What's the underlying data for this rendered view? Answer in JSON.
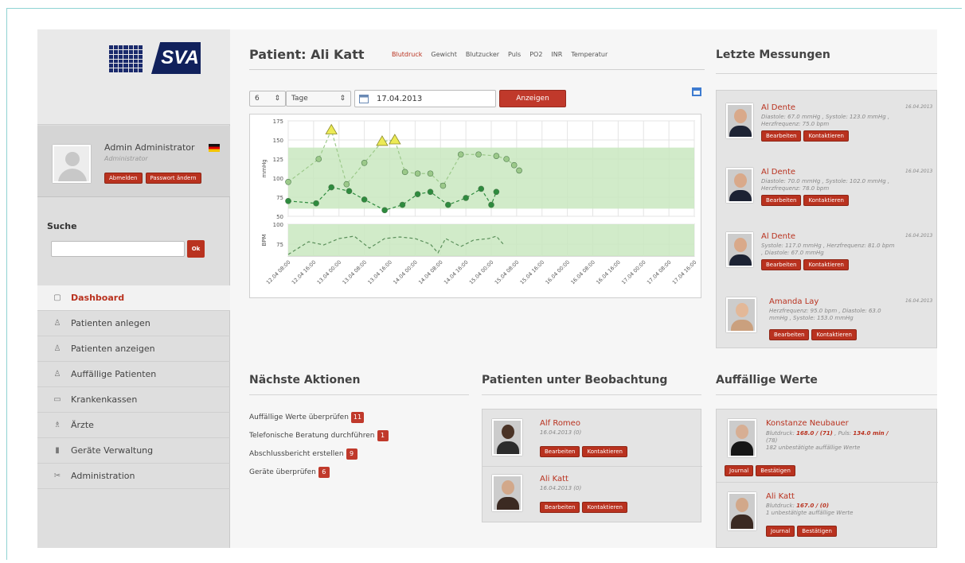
{
  "sidebar": {
    "user": {
      "name": "Admin Administrator",
      "role": "Administrator",
      "btn_logout": "Abmelden",
      "btn_password": "Passwort ändern"
    },
    "search": {
      "label": "Suche",
      "button": "Ok",
      "placeholder": ""
    },
    "nav": [
      {
        "label": "Dashboard",
        "icon": "dashboard-icon",
        "active": true
      },
      {
        "label": "Patienten anlegen",
        "icon": "user-add-icon"
      },
      {
        "label": "Patienten anzeigen",
        "icon": "user-icon"
      },
      {
        "label": "Auffällige Patienten",
        "icon": "user-alert-icon"
      },
      {
        "label": "Krankenkassen",
        "icon": "card-icon"
      },
      {
        "label": "Ärzte",
        "icon": "doctor-icon"
      },
      {
        "label": "Geräte Verwaltung",
        "icon": "device-icon"
      },
      {
        "label": "Administration",
        "icon": "wrench-icon"
      }
    ]
  },
  "patient": {
    "title": "Patient: Ali Katt",
    "tabs": [
      "Blutdruck",
      "Gewicht",
      "Blutzucker",
      "Puls",
      "PO2",
      "INR",
      "Temperatur"
    ],
    "controls": {
      "count": "6",
      "unit": "Tage",
      "date": "17.04.2013",
      "show_button": "Anzeigen"
    }
  },
  "chart_data": {
    "type": "line",
    "x": [
      "12.04 08:00",
      "12.04 16:00",
      "13.04 00:00",
      "13.04 08:00",
      "13.04 16:00",
      "14.04 00:00",
      "14.04 08:00",
      "14.04 16:00",
      "15.04 00:00",
      "15.04 08:00",
      "15.04 16:00",
      "16.04 00:00",
      "16.04 08:00",
      "16.04 16:00",
      "17.04 00:00",
      "17.04 08:00",
      "17.04 16:00"
    ],
    "panels": [
      {
        "ylabel": "mmHg",
        "ylim": [
          50,
          175
        ],
        "yticks": [
          50,
          75,
          100,
          125,
          150,
          175
        ],
        "normal_range": [
          60,
          140
        ],
        "series": [
          {
            "points": [
              [
                0,
                95
              ],
              [
                1.2,
                125
              ],
              [
                1.7,
                163
              ],
              [
                2.3,
                92
              ],
              [
                3.0,
                120
              ],
              [
                3.7,
                148
              ],
              [
                4.2,
                150
              ],
              [
                4.6,
                108
              ],
              [
                5.1,
                106
              ],
              [
                5.6,
                106
              ],
              [
                6.1,
                90
              ],
              [
                6.8,
                131
              ],
              [
                7.5,
                131
              ],
              [
                8.2,
                129
              ],
              [
                8.6,
                125
              ],
              [
                8.9,
                117
              ],
              [
                9.1,
                110
              ]
            ],
            "triangle_indices": [
              2,
              5,
              6
            ]
          },
          {
            "points": [
              [
                0,
                70
              ],
              [
                1.1,
                67
              ],
              [
                1.7,
                88
              ],
              [
                2.4,
                83
              ],
              [
                3.0,
                72
              ],
              [
                3.8,
                58
              ],
              [
                4.5,
                65
              ],
              [
                5.1,
                79
              ],
              [
                5.6,
                82
              ],
              [
                6.3,
                65
              ],
              [
                7.0,
                74
              ],
              [
                7.6,
                86
              ],
              [
                8.0,
                65
              ],
              [
                8.2,
                82
              ]
            ]
          }
        ]
      },
      {
        "ylabel": "BPM",
        "ylim": [
          60,
          100
        ],
        "yticks": [
          75,
          100
        ],
        "normal_range": [
          60,
          100
        ],
        "series": [
          {
            "points": [
              [
                0,
                62
              ],
              [
                0.8,
                78
              ],
              [
                1.4,
                74
              ],
              [
                2.0,
                82
              ],
              [
                2.6,
                85
              ],
              [
                3.2,
                70
              ],
              [
                3.8,
                82
              ],
              [
                4.4,
                84
              ],
              [
                5.0,
                82
              ],
              [
                5.6,
                75
              ],
              [
                5.9,
                64
              ],
              [
                6.2,
                82
              ],
              [
                6.8,
                72
              ],
              [
                7.3,
                80
              ],
              [
                7.9,
                82
              ],
              [
                8.2,
                85
              ],
              [
                8.5,
                74
              ]
            ]
          }
        ]
      }
    ]
  },
  "last_measurements": {
    "title": "Letzte Messungen",
    "items": [
      {
        "name": "Al Dente",
        "date": "16.04.2013",
        "text1": "Diastole: 67.0 mmHg , Systole: 123.0 mmHg ,",
        "text2": "Herzfrequenz: 75.0 bpm",
        "b1": "Bearbeiten",
        "b2": "Kontaktieren"
      },
      {
        "name": "Al Dente",
        "date": "16.04.2013",
        "text1": "Diastole: 70.0 mmHg , Systole: 102.0 mmHg ,",
        "text2": "Herzfrequenz: 78.0 bpm",
        "b1": "Bearbeiten",
        "b2": "Kontaktieren"
      },
      {
        "name": "Al Dente",
        "date": "16.04.2013",
        "text1": "Systole: 117.0 mmHg , Herzfrequenz: 81.0 bpm",
        "text2": ", Diastole: 67.0 mmHg",
        "b1": "Bearbeiten",
        "b2": "Kontaktieren"
      },
      {
        "name": "Amanda Lay",
        "date": "16.04.2013",
        "text1": "Herzfrequenz: 95.0 bpm , Diastole: 63.0",
        "text2": "mmHg , Systole: 153.0 mmHg",
        "b1": "Bearbeiten",
        "b2": "Kontaktieren"
      }
    ]
  },
  "next_actions": {
    "title": "Nächste Aktionen",
    "items": [
      {
        "label": "Auffällige Werte überprüfen",
        "count": "11"
      },
      {
        "label": "Telefonische Beratung durchführen",
        "count": "1"
      },
      {
        "label": "Abschlussbericht erstellen",
        "count": "9"
      },
      {
        "label": "Geräte überprüfen",
        "count": "6"
      }
    ]
  },
  "observation": {
    "title": "Patienten unter Beobachtung",
    "items": [
      {
        "name": "Alf Romeo",
        "date": "16.04.2013 (0)",
        "b1": "Bearbeiten",
        "b2": "Kontaktieren"
      },
      {
        "name": "Ali Katt",
        "date": "16.04.2013 (0)",
        "b1": "Bearbeiten",
        "b2": "Kontaktieren"
      }
    ]
  },
  "abnormal": {
    "title": "Auffällige Werte",
    "items": [
      {
        "name": "Konstanze Neubauer",
        "line1_pre": "Blutdruck: ",
        "line1_val": "168.0 / (71)",
        "line1_mid": " , Puls: ",
        "line1_val2": "134.0 min /",
        "line2": "(78)",
        "line3": "182 unbestätigte auffällige Werte",
        "b1": "Journal",
        "b2": "Bestätigen"
      },
      {
        "name": "Ali Katt",
        "line1_pre": "Blutdruck: ",
        "line1_val": "167.0 / (0)",
        "line2": "1 unbestätigte auffällige Werte",
        "b1": "Journal",
        "b2": "Bestätigen"
      }
    ]
  },
  "colors": {
    "accent": "#b9321f",
    "chart_band": "#c9e8c0",
    "series_dark": "#2e8b3e",
    "series_light": "#9cc98a",
    "triangle": "#ecea55"
  }
}
